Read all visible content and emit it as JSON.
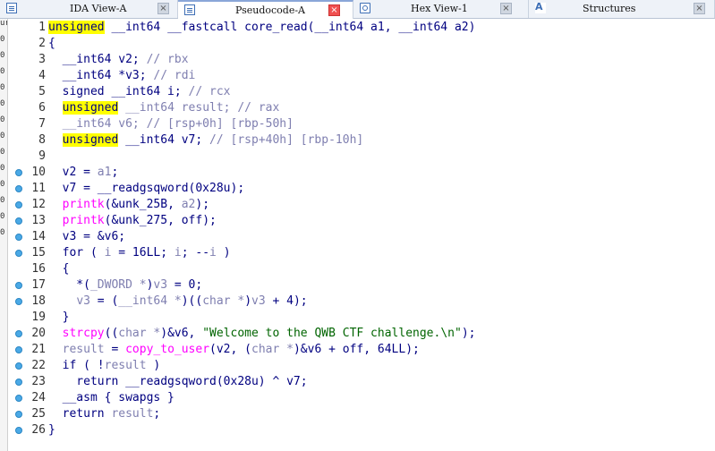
{
  "tabs": [
    {
      "label": "IDA View-A",
      "active": false,
      "icon": "list-icon"
    },
    {
      "label": "Pseudocode-A",
      "active": true,
      "icon": "list-icon"
    },
    {
      "label": "Hex View-1",
      "active": false,
      "icon": "hex-icon"
    },
    {
      "label": "Structures",
      "active": false,
      "icon": "structures-icon"
    }
  ],
  "close_glyph": "×",
  "left_strip": [
    "ur",
    "0",
    "0",
    "0",
    "0",
    "0",
    "0",
    "0",
    "0",
    "0",
    "0",
    "0",
    "0",
    "0"
  ],
  "code": {
    "lines": [
      {
        "n": "1",
        "bp": false,
        "segs": [
          [
            "hl",
            "unsigned"
          ],
          [
            "p",
            " __int64 __fastcall core_read(__int64 a1, __int64 a2)"
          ]
        ]
      },
      {
        "n": "2",
        "bp": false,
        "segs": [
          [
            "p",
            "{"
          ]
        ]
      },
      {
        "n": "3",
        "bp": false,
        "segs": [
          [
            "p",
            "  __int64 v2; "
          ],
          [
            "cm",
            "// rbx"
          ]
        ]
      },
      {
        "n": "4",
        "bp": false,
        "segs": [
          [
            "p",
            "  __int64 *v3; "
          ],
          [
            "cm",
            "// rdi"
          ]
        ]
      },
      {
        "n": "5",
        "bp": false,
        "segs": [
          [
            "p",
            "  signed __int64 i; "
          ],
          [
            "cm",
            "// rcx"
          ]
        ]
      },
      {
        "n": "6",
        "bp": false,
        "segs": [
          [
            "p",
            "  "
          ],
          [
            "hl",
            "unsigned"
          ],
          [
            "cm",
            " __int64 result; // rax"
          ]
        ]
      },
      {
        "n": "7",
        "bp": false,
        "segs": [
          [
            "cm",
            "  __int64 v6; // [rsp+0h] [rbp-50h]"
          ]
        ]
      },
      {
        "n": "8",
        "bp": false,
        "segs": [
          [
            "p",
            "  "
          ],
          [
            "hl",
            "unsigned"
          ],
          [
            "p",
            " __int64 v7; "
          ],
          [
            "cm",
            "// [rsp+40h] [rbp-10h]"
          ]
        ]
      },
      {
        "n": "9",
        "bp": false,
        "segs": [
          [
            "p",
            ""
          ]
        ]
      },
      {
        "n": "10",
        "bp": true,
        "segs": [
          [
            "p",
            "  v2 = "
          ],
          [
            "cm",
            "a1"
          ],
          [
            "p",
            ";"
          ]
        ]
      },
      {
        "n": "11",
        "bp": true,
        "segs": [
          [
            "p",
            "  v7 = __readgsqword(0x28u);"
          ]
        ]
      },
      {
        "n": "12",
        "bp": true,
        "segs": [
          [
            "fn",
            "  printk"
          ],
          [
            "p",
            "(&unk_25B, "
          ],
          [
            "cm",
            "a2"
          ],
          [
            "p",
            ");"
          ]
        ]
      },
      {
        "n": "13",
        "bp": true,
        "segs": [
          [
            "fn",
            "  printk"
          ],
          [
            "p",
            "(&unk_275, off);"
          ]
        ]
      },
      {
        "n": "14",
        "bp": true,
        "segs": [
          [
            "p",
            "  v3 = &v6;"
          ]
        ]
      },
      {
        "n": "15",
        "bp": true,
        "segs": [
          [
            "p",
            "  for ( "
          ],
          [
            "cm",
            "i"
          ],
          [
            "p",
            " = 16LL; "
          ],
          [
            "cm",
            "i"
          ],
          [
            "p",
            "; --"
          ],
          [
            "cm",
            "i"
          ],
          [
            "p",
            " )"
          ]
        ]
      },
      {
        "n": "16",
        "bp": false,
        "segs": [
          [
            "p",
            "  {"
          ]
        ]
      },
      {
        "n": "17",
        "bp": true,
        "segs": [
          [
            "p",
            "    *("
          ],
          [
            "cm",
            "_DWORD *"
          ],
          [
            "p",
            ")"
          ],
          [
            "cm",
            "v3"
          ],
          [
            "p",
            " = 0;"
          ]
        ]
      },
      {
        "n": "18",
        "bp": true,
        "segs": [
          [
            "p",
            "    "
          ],
          [
            "cm",
            "v3"
          ],
          [
            "p",
            " = ("
          ],
          [
            "cm",
            "__int64 *"
          ],
          [
            "p",
            ")(("
          ],
          [
            "cm",
            "char *"
          ],
          [
            "p",
            ")"
          ],
          [
            "cm",
            "v3"
          ],
          [
            "p",
            " + 4);"
          ]
        ]
      },
      {
        "n": "19",
        "bp": false,
        "segs": [
          [
            "p",
            "  }"
          ]
        ]
      },
      {
        "n": "20",
        "bp": true,
        "segs": [
          [
            "fn",
            "  strcpy"
          ],
          [
            "p",
            "(("
          ],
          [
            "cm",
            "char *"
          ],
          [
            "p",
            ")&v6, "
          ],
          [
            "st",
            "\"Welcome to the QWB CTF challenge.\\n\""
          ],
          [
            "p",
            ");"
          ]
        ]
      },
      {
        "n": "21",
        "bp": true,
        "segs": [
          [
            "p",
            "  "
          ],
          [
            "cm",
            "result"
          ],
          [
            "p",
            " = "
          ],
          [
            "fn",
            "copy_to_user"
          ],
          [
            "p",
            "(v2, ("
          ],
          [
            "cm",
            "char *"
          ],
          [
            "p",
            ")&v6 + off, 64LL);"
          ]
        ]
      },
      {
        "n": "22",
        "bp": true,
        "segs": [
          [
            "p",
            "  if ( !"
          ],
          [
            "cm",
            "result"
          ],
          [
            "p",
            " )"
          ]
        ]
      },
      {
        "n": "23",
        "bp": true,
        "segs": [
          [
            "p",
            "    return __readgsqword(0x28u) ^ v7;"
          ]
        ]
      },
      {
        "n": "24",
        "bp": true,
        "segs": [
          [
            "p",
            "  __asm { swapgs }"
          ]
        ]
      },
      {
        "n": "25",
        "bp": true,
        "segs": [
          [
            "p",
            "  return "
          ],
          [
            "cm",
            "result"
          ],
          [
            "p",
            ";"
          ]
        ]
      },
      {
        "n": "26",
        "bp": true,
        "segs": [
          [
            "p",
            "}"
          ]
        ]
      }
    ]
  }
}
